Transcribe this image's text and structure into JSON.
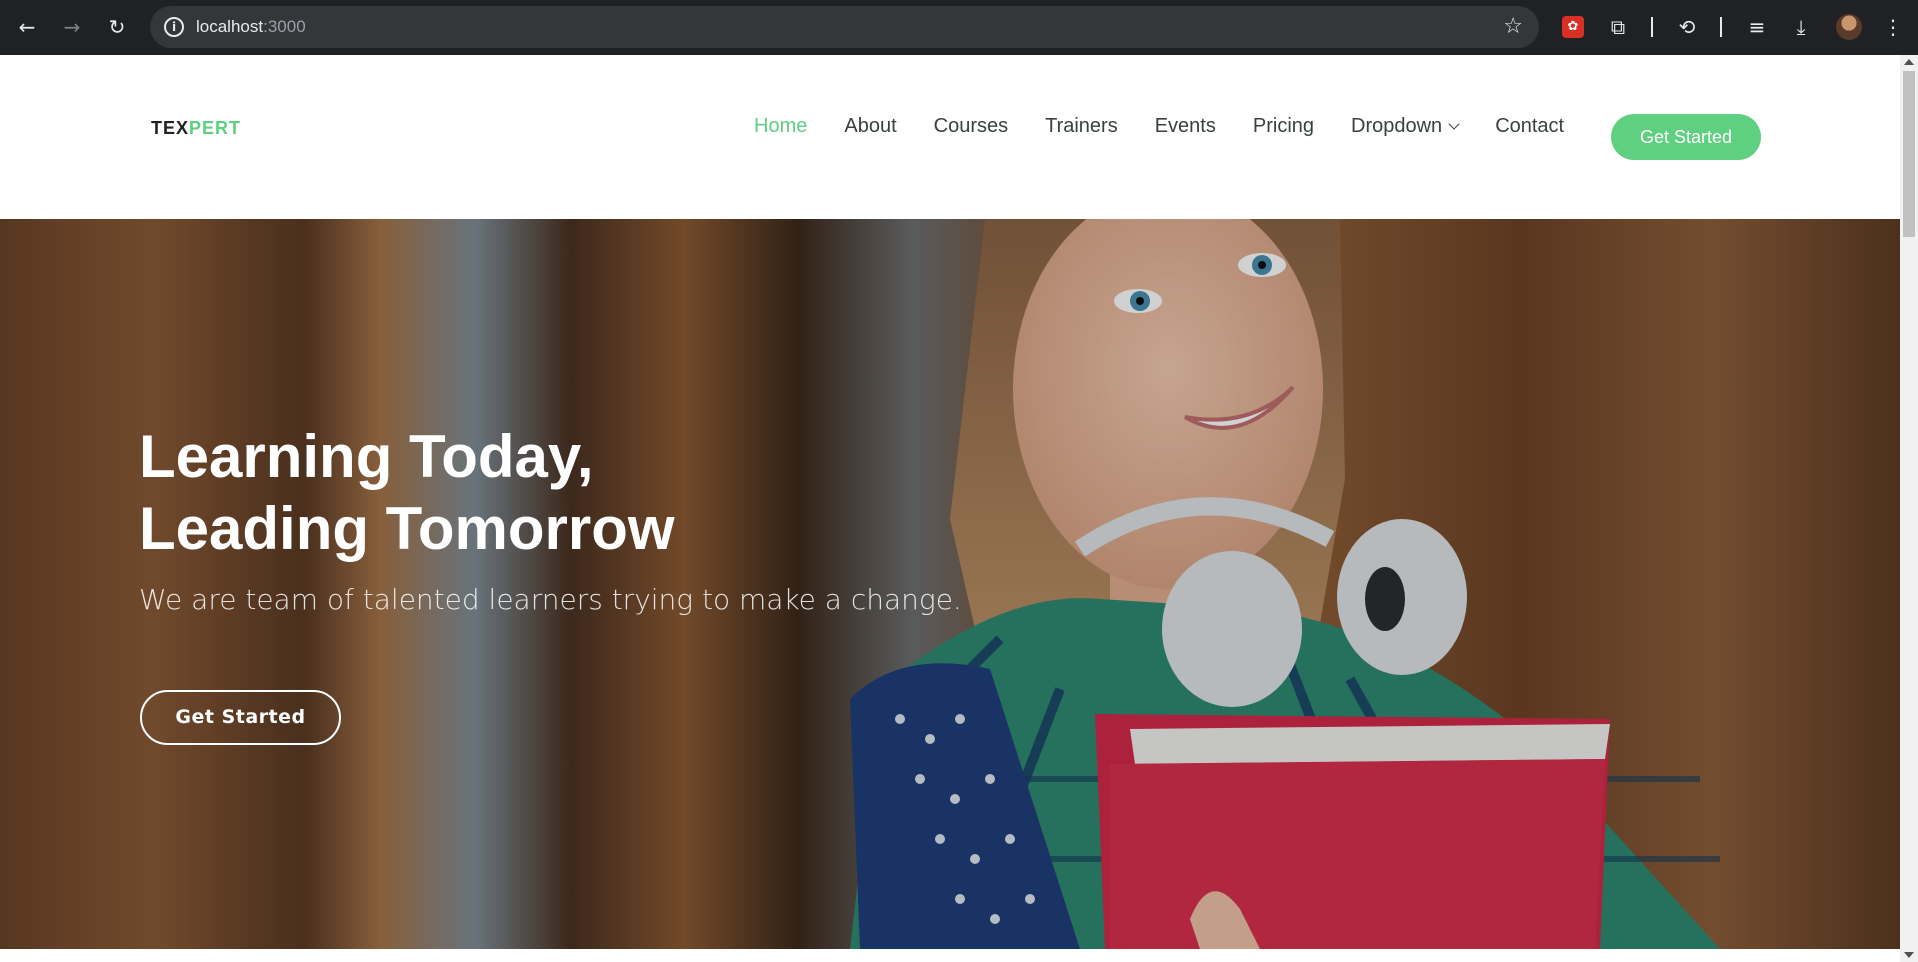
{
  "browser": {
    "url_host": "localhost",
    "url_port": ":3000",
    "icons": {
      "back": "back-arrow-icon",
      "forward": "forward-arrow-icon",
      "reload": "reload-icon",
      "info": "site-info-icon",
      "star": "bookmark-star-icon",
      "extensions": "extensions-puzzle-icon",
      "history": "history-icon",
      "media": "media-queue-icon",
      "download": "download-icon",
      "menu": "kebab-menu-icon"
    }
  },
  "site": {
    "logo_primary": "TEX",
    "logo_accent": "PERT",
    "nav": [
      {
        "label": "Home",
        "active": true
      },
      {
        "label": "About"
      },
      {
        "label": "Courses"
      },
      {
        "label": "Trainers"
      },
      {
        "label": "Events"
      },
      {
        "label": "Pricing"
      },
      {
        "label": "Dropdown"
      },
      {
        "label": "Contact"
      }
    ],
    "cta_label": "Get Started",
    "accent_color": "#5fcf80"
  },
  "hero": {
    "title_line1": "Learning Today,",
    "title_line2": "Leading Tomorrow",
    "subtitle": "We are team of talented learners trying to make a change.",
    "button_label": "Get Started"
  }
}
